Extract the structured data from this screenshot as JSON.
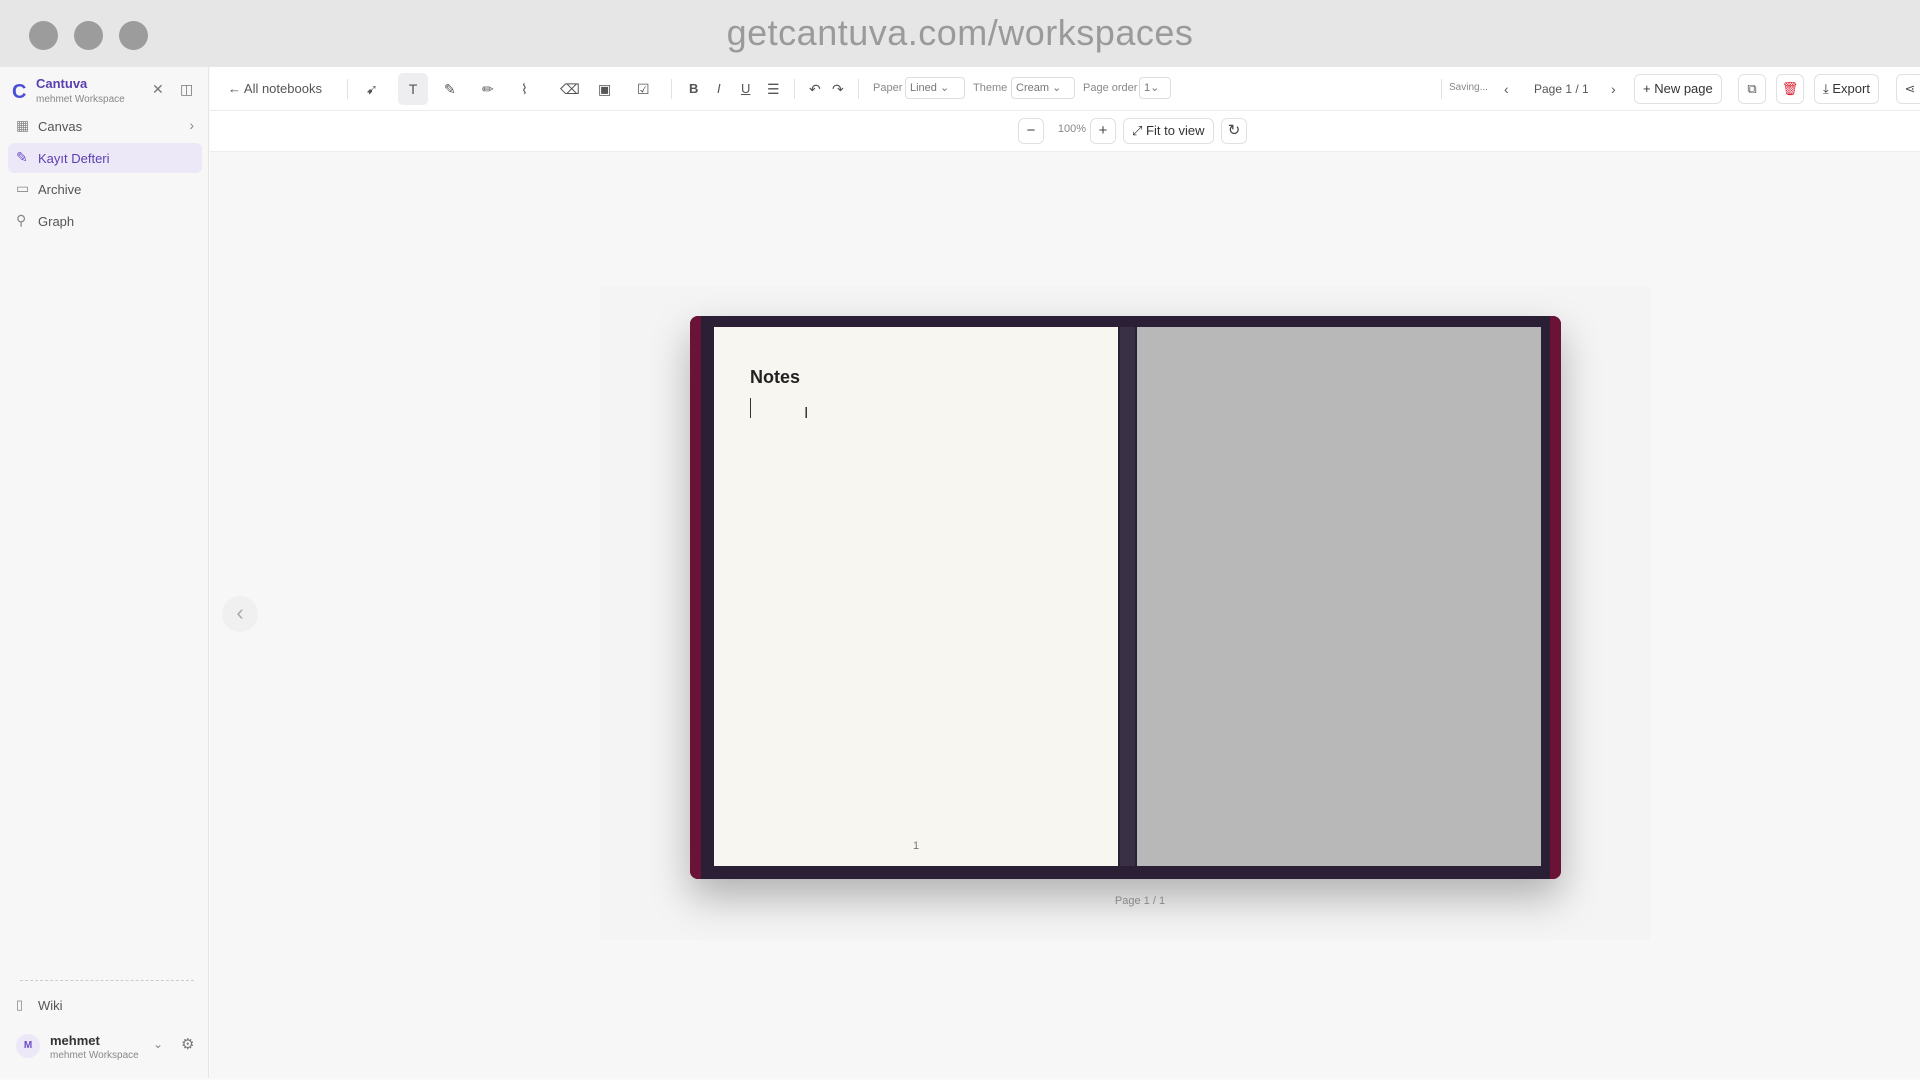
{
  "browser": {
    "url": "getcantuva.com/workspaces"
  },
  "sidebar": {
    "brand": {
      "logo": "C",
      "name": "Cantuva",
      "workspace": "mehmet Workspace"
    },
    "items": [
      {
        "label": "Canvas",
        "icon": "grid-icon"
      },
      {
        "label": "Kayıt Defteri",
        "icon": "edit-icon"
      },
      {
        "label": "Archive",
        "icon": "archive-icon"
      },
      {
        "label": "Graph",
        "icon": "graph-icon"
      }
    ],
    "wiki": {
      "label": "Wiki"
    },
    "user": {
      "initial": "M",
      "name": "mehmet",
      "workspace": "mehmet Workspace"
    }
  },
  "toolbar": {
    "back_label": "← All notebooks",
    "bold": "B",
    "italic": "I",
    "underline": "U",
    "paper_label": "Paper",
    "paper_value": "Lined",
    "theme_label": "Theme",
    "theme_value": "Cream",
    "page_order_label": "Page order",
    "page_order_value": "1",
    "status": "Saving...",
    "page_counter": "Page 1 / 1",
    "new_page": "+ New page",
    "export": "Export"
  },
  "zoom": {
    "level": "100%",
    "fit_label": "Fit to view"
  },
  "notebook": {
    "title": "Notes",
    "page_number": "1",
    "page_indicator": "Page 1 / 1"
  }
}
